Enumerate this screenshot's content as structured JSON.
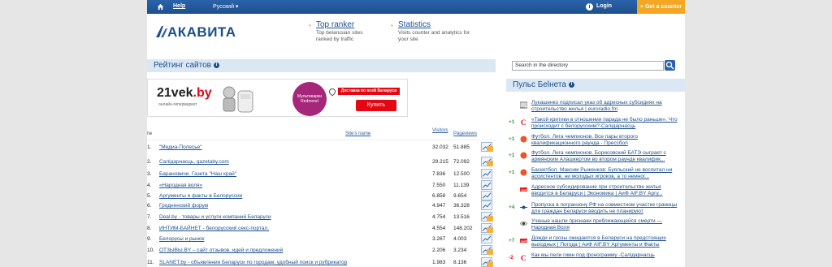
{
  "topnav": {
    "help": "Help",
    "language": "Русский ▾",
    "login": "Login",
    "get_counter": "+ Get a counter",
    "login_icon_glyph": "i"
  },
  "logo": {
    "text": "АКАВИТА"
  },
  "promos": [
    {
      "title": "Top ranker",
      "desc1": "Top belarusian sites",
      "desc2": "ranked by traffic"
    },
    {
      "title": "Statistics",
      "desc1": "Visits counter and analytics for",
      "desc2": "your site"
    }
  ],
  "rating": {
    "title": "Рейтинг сайтов",
    "info_glyph": "i"
  },
  "banner": {
    "brand_main": "21vek",
    "brand_dot": ".by",
    "brand_sub": "онлайн-гипермаркет",
    "circle_text": "Мультиварки Redmond",
    "delivery": "Доставка по всей Беларуси",
    "buy": "Купить"
  },
  "table": {
    "col_no": "№",
    "col_site": "Site's name",
    "col_visitors": "Visitors",
    "col_pageviews": "Pageviews",
    "rows": [
      {
        "n": "1.",
        "name": "\"Медиа-Полесье\"",
        "visitors": "32.032",
        "pageviews": "51.885"
      },
      {
        "n": "2.",
        "name": "Салiдарнасць, gazetaby.com",
        "visitors": "29.215",
        "pageviews": "72.092"
      },
      {
        "n": "3.",
        "name": "Барановичи. Газета \"Наш край\"",
        "visitors": "7.836",
        "pageviews": "12.500"
      },
      {
        "n": "4.",
        "name": "«Народная воля»",
        "visitors": "7.550",
        "pageviews": "11.139"
      },
      {
        "n": "5.",
        "name": "Аргументы и факты в Белоруссии",
        "visitors": "6.858",
        "pageviews": "9.654"
      },
      {
        "n": "6.",
        "name": "Гродненский форум",
        "visitors": "4.947",
        "pageviews": "36.328"
      },
      {
        "n": "7.",
        "name": "Deal.by - товары и услуги компаний Беларуси",
        "visitors": "4.754",
        "pageviews": "13.516"
      },
      {
        "n": "8.",
        "name": "ИНТИМ-БАЙНЕТ - белорусский секс-портал.",
        "visitors": "4.554",
        "pageviews": "148.202"
      },
      {
        "n": "9.",
        "name": "Белорусы и рынок",
        "visitors": "3.267",
        "pageviews": "4.003"
      },
      {
        "n": "10.",
        "name": "ОТЗЫВЫ.BY – сайт отзывов, идей и предложений",
        "visitors": "2.206",
        "pageviews": "3.234"
      },
      {
        "n": "11.",
        "name": "SLANET.by - объявления Беларуси по городам, удобный поиск и рубрикатор",
        "visitors": "1.983",
        "pageviews": "8.136"
      }
    ]
  },
  "search": {
    "placeholder": "Search in the directory"
  },
  "pulse": {
    "title": "Пульс Беlнета",
    "items": [
      {
        "score": "",
        "icon": "newspaper-icon",
        "text": "Лукашенко подписал указ об адресных субсидиях на строительство жилья | euroradio.fm"
      },
      {
        "score": "+1",
        "icon": "c-logo-icon",
        "text": "«Такой критики в отношении парада не было раньше». Что происходит с белорусским?-Салiдарнасць"
      },
      {
        "score": "+1",
        "icon": "ball-icon",
        "text": "Футбол. Лига чемпионов. Все пары второго квалификационного раунда - Прессбол"
      },
      {
        "score": "+1",
        "icon": "ball-icon",
        "text": "Футбол. Лига чемпионов. Борисовский БАТЭ сыграет с армянским Алашкертом во втором раунде квалифик..."
      },
      {
        "score": "+1",
        "icon": "ball-icon",
        "text": "Баскетбол. Максим Рыженков: Буяльский не воспитал ни ассистентов, ни молодых игроков, а то немног..."
      },
      {
        "score": "",
        "icon": "aif-icon",
        "text": "Адресное субсидирование при строительстве жилья вводится в Беларуси | Экономика | АиФ AIF.BY Аргу..."
      },
      {
        "score": "+4",
        "icon": "pin-icon",
        "text": "Пропуска в погранзону РФ на совместном участке границы для граждан Беларуси вводить не планируют"
      },
      {
        "score": "",
        "icon": "eye-icon",
        "text": "Ученые нашли признаки приближающейся смерти — Народная Воля"
      },
      {
        "score": "+7",
        "icon": "aif-icon",
        "text": "Дожди и грозы ожидаются в Беларуси на предстоящих выходных | Погода | АиФ AIF.BY Аргументы и Факты"
      },
      {
        "score": "-2",
        "icon": "c-logo-icon",
        "text": "Как мы пели гимн под фонограмму -Салiдарнасць"
      }
    ]
  },
  "colors": {
    "brand": "#1d4f8c",
    "accent": "#f5a623",
    "header_bg": "#dbe8f4"
  }
}
